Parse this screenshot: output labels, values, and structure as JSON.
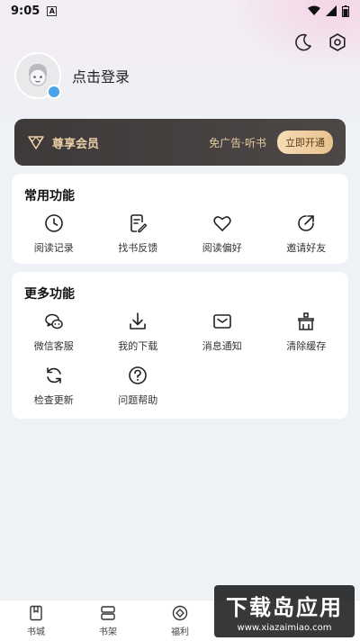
{
  "status_bar": {
    "time": "9:05",
    "notification_icon": "A"
  },
  "profile": {
    "login_text": "点击登录"
  },
  "vip": {
    "title": "尊享会员",
    "perks": "免广告·听书",
    "button": "立即开通"
  },
  "common": {
    "title": "常用功能",
    "items": [
      {
        "label": "阅读记录",
        "icon": "clock-icon"
      },
      {
        "label": "找书反馈",
        "icon": "edit-note-icon"
      },
      {
        "label": "阅读偏好",
        "icon": "heart-icon"
      },
      {
        "label": "邀请好友",
        "icon": "share-icon"
      }
    ]
  },
  "more": {
    "title": "更多功能",
    "items": [
      {
        "label": "微信客服",
        "icon": "wechat-icon"
      },
      {
        "label": "我的下载",
        "icon": "download-icon"
      },
      {
        "label": "消息通知",
        "icon": "mail-icon"
      },
      {
        "label": "清除缓存",
        "icon": "broom-icon"
      },
      {
        "label": "检查更新",
        "icon": "refresh-icon"
      },
      {
        "label": "问题帮助",
        "icon": "help-icon"
      }
    ]
  },
  "nav": {
    "items": [
      {
        "label": "书城",
        "icon": "book-icon"
      },
      {
        "label": "书架",
        "icon": "shelf-icon"
      },
      {
        "label": "福利",
        "icon": "gift-icon"
      }
    ]
  },
  "watermark": {
    "title": "下载岛应用",
    "url": "www.xiazaimiao.com"
  }
}
